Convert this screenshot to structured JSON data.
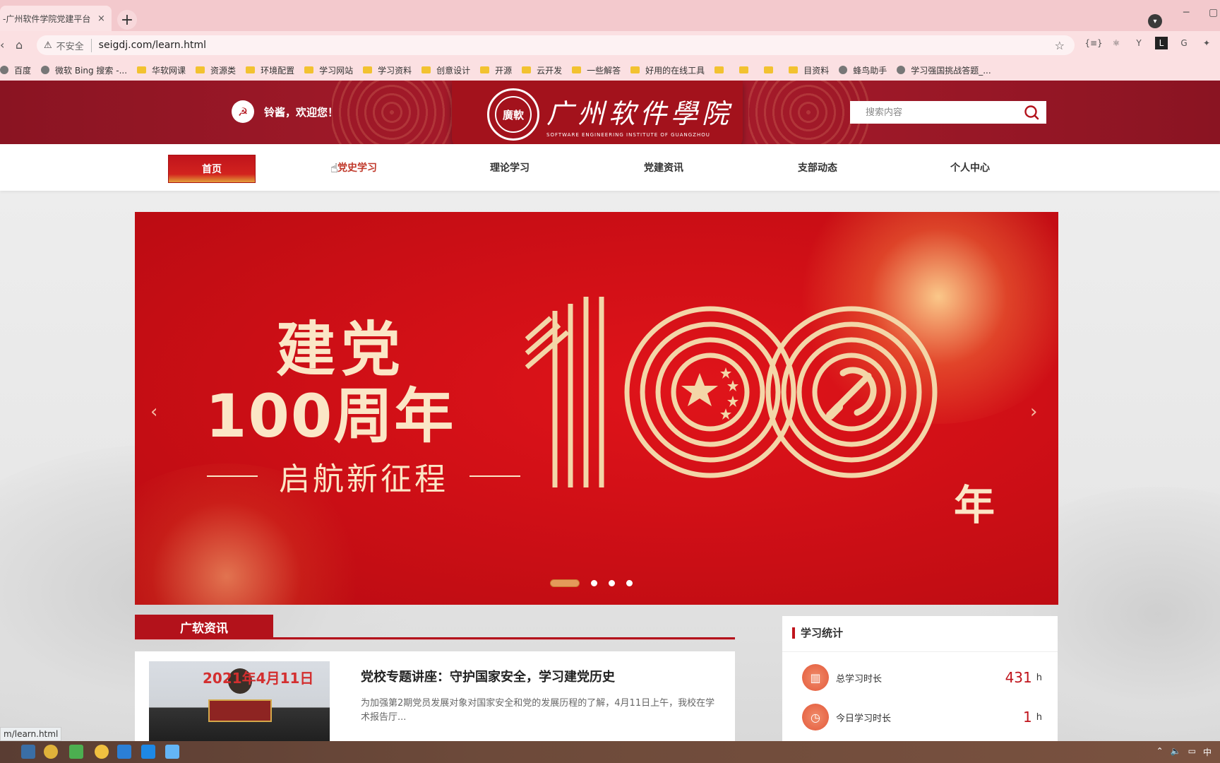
{
  "browser": {
    "tab_title": "-广州软件学院党建平台",
    "tab_close": "×",
    "new_tab": "+",
    "insecure_label": "不安全",
    "url": "seigdj.com/learn.html",
    "status_url": "m/learn.html"
  },
  "bookmarks": [
    {
      "label": "百度",
      "icon": "baidu"
    },
    {
      "label": "微软 Bing 搜索 -...",
      "icon": "bing"
    },
    {
      "label": "华软网课",
      "icon": "folder"
    },
    {
      "label": "资源类",
      "icon": "folder"
    },
    {
      "label": "环境配置",
      "icon": "folder"
    },
    {
      "label": "学习网站",
      "icon": "folder"
    },
    {
      "label": "学习资料",
      "icon": "folder"
    },
    {
      "label": "创意设计",
      "icon": "folder"
    },
    {
      "label": "开源",
      "icon": "folder"
    },
    {
      "label": "云开发",
      "icon": "folder"
    },
    {
      "label": "一些解答",
      "icon": "folder"
    },
    {
      "label": "好用的在线工具",
      "icon": "folder"
    },
    {
      "label": "",
      "icon": "folder"
    },
    {
      "label": "",
      "icon": "folder"
    },
    {
      "label": "",
      "icon": "folder"
    },
    {
      "label": "目资料",
      "icon": "folder"
    },
    {
      "label": "蜂鸟助手",
      "icon": "globe"
    },
    {
      "label": "学习强国挑战答题_...",
      "icon": "page"
    }
  ],
  "header": {
    "welcome": "铃酱，欢迎您！",
    "logo_cn": "广州软件學院",
    "logo_en": "SOFTWARE ENGINEERING INSTITUTE OF GUANGZHOU",
    "seal_text": "廣軟",
    "search_placeholder": "搜索内容"
  },
  "nav": {
    "items": [
      {
        "label": "首页"
      },
      {
        "label": "党史学习"
      },
      {
        "label": "理论学习"
      },
      {
        "label": "党建资讯"
      },
      {
        "label": "支部动态"
      },
      {
        "label": "个人中心"
      }
    ],
    "active_index": 0
  },
  "banner": {
    "line1": "建党",
    "line2": "100周年",
    "subtitle": "启航新征程",
    "number": "100",
    "nian": "年",
    "prev": "‹",
    "next": "›",
    "slide_count": 4,
    "active_slide": 0
  },
  "news": {
    "section_title": "广软资讯",
    "items": [
      {
        "thumb_date": "2021年4月11日",
        "title": "党校专题讲座：守护国家安全，学习建党历史",
        "summary": "为加强第2期党员发展对象对国家安全和党的发展历程的了解，4月11日上午，我校在学术报告厅..."
      }
    ]
  },
  "stats": {
    "title": "学习统计",
    "rows": [
      {
        "label": "总学习时长",
        "value": "431",
        "unit": "h",
        "icon": "bar-chart-icon"
      },
      {
        "label": "今日学习时长",
        "value": "1",
        "unit": "h",
        "icon": "clock-icon"
      }
    ]
  },
  "colors": {
    "brand_red": "#b3121b",
    "header_red": "#a51a2a",
    "banner_red": "#d0101a",
    "gold": "#fbe6c6"
  }
}
